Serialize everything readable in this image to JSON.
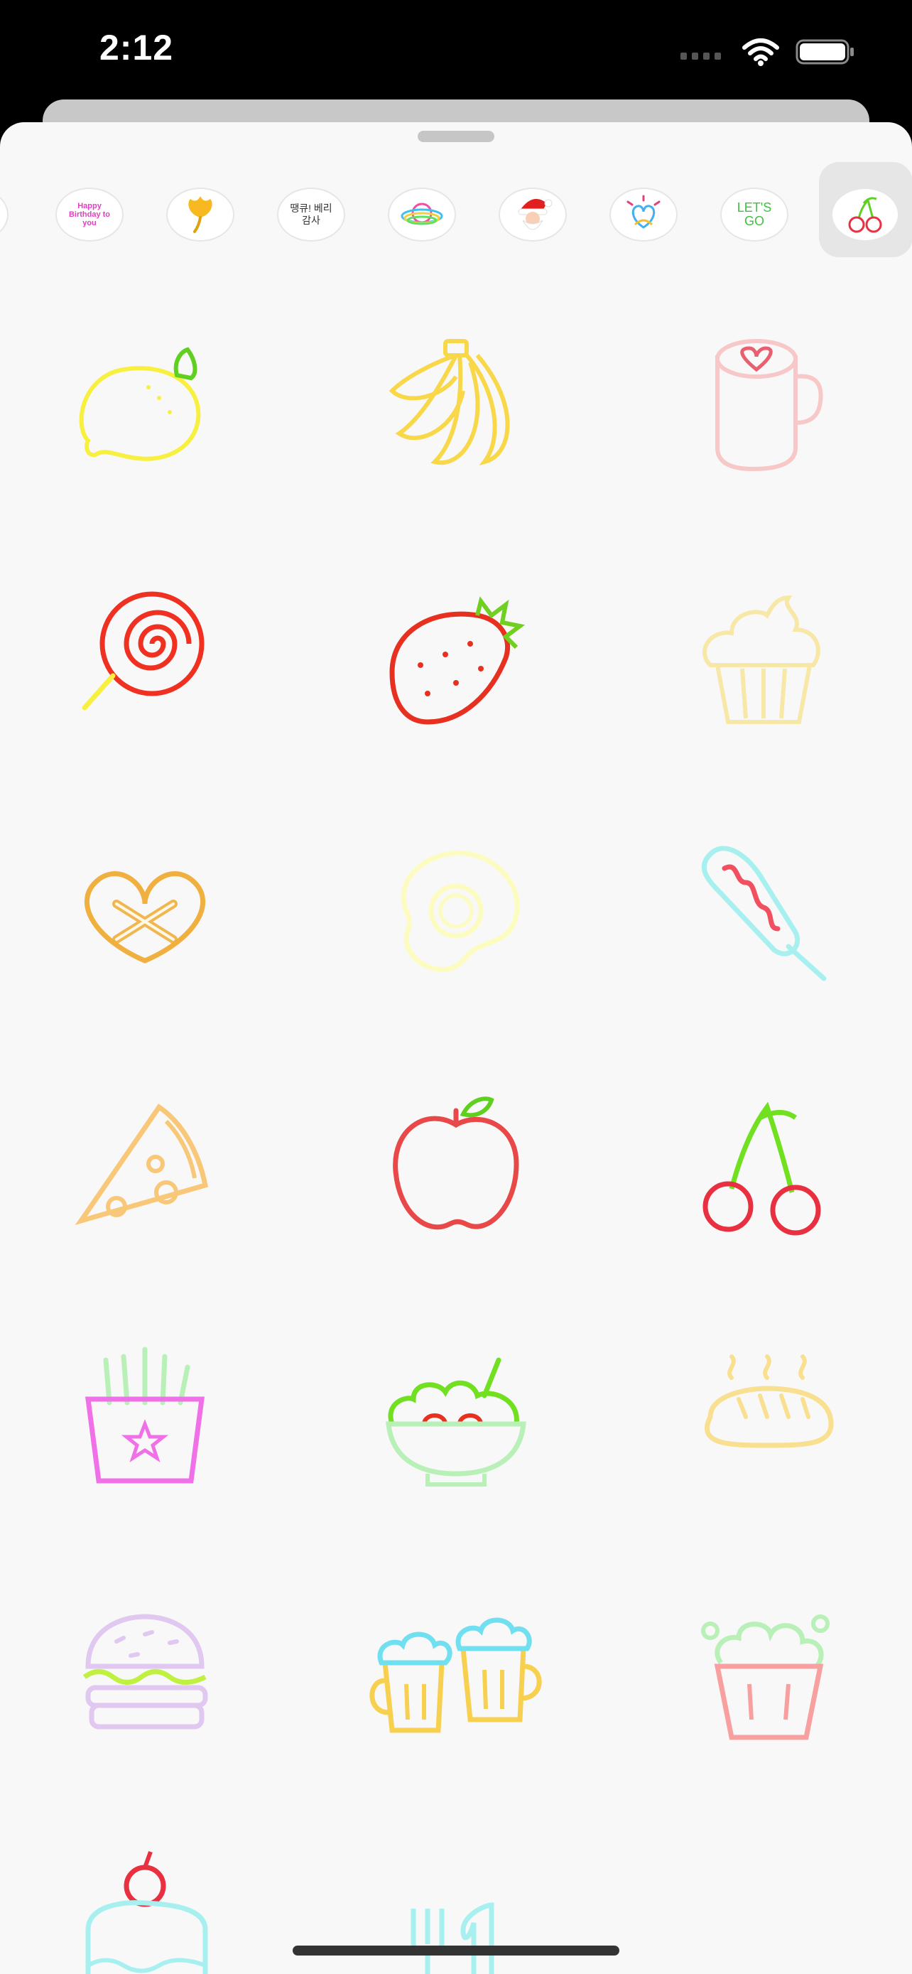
{
  "status_bar": {
    "time": "2:12"
  },
  "sticker_tray": {
    "packs": [
      {
        "name": "happy-birthday-pack",
        "text": "Happy Birthday to you"
      },
      {
        "name": "ginkgo-leaf-pack",
        "text": ""
      },
      {
        "name": "korean-text-pack",
        "text": "땡큐! 베리감사"
      },
      {
        "name": "rainbow-planet-pack",
        "text": ""
      },
      {
        "name": "santa-pack",
        "text": ""
      },
      {
        "name": "heart-doodle-pack",
        "text": ""
      },
      {
        "name": "lets-go-pack",
        "text": "LET'S GO"
      },
      {
        "name": "cherry-pack",
        "text": "",
        "selected": true
      }
    ]
  },
  "stickers": [
    {
      "name": "lemon",
      "color": "#f8f040"
    },
    {
      "name": "banana",
      "color": "#f8d848"
    },
    {
      "name": "coffee-mug",
      "color": "#f8c8c8"
    },
    {
      "name": "lollipop",
      "color": "#f03020"
    },
    {
      "name": "strawberry",
      "color": "#e83020"
    },
    {
      "name": "cupcake",
      "color": "#f8e8a8"
    },
    {
      "name": "pretzel",
      "color": "#f0b040"
    },
    {
      "name": "fried-egg",
      "color": "#fcfcc0"
    },
    {
      "name": "corn-dog",
      "color": "#a8f0f0"
    },
    {
      "name": "pizza-slice",
      "color": "#f8c878"
    },
    {
      "name": "apple",
      "color": "#e84848"
    },
    {
      "name": "cherry",
      "color": "#e83040"
    },
    {
      "name": "french-fries",
      "color": "#f070e8"
    },
    {
      "name": "salad-bowl",
      "color": "#b8f0b8"
    },
    {
      "name": "bread",
      "color": "#f8e090"
    },
    {
      "name": "hamburger",
      "color": "#e0c8f0"
    },
    {
      "name": "beer-mugs",
      "color": "#f8d050"
    },
    {
      "name": "popcorn",
      "color": "#f8a0a0"
    },
    {
      "name": "cake-slice",
      "color": "#a8f0f0"
    },
    {
      "name": "fork-knife",
      "color": "#a8f0f0"
    }
  ]
}
